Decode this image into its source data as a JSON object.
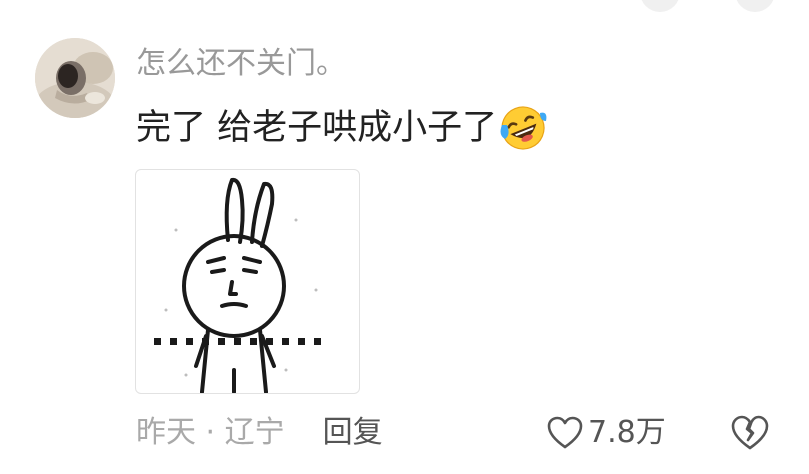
{
  "comment": {
    "username": "怎么还不关门。",
    "text": "完了 给老子哄成小子了",
    "emoji_icon": "rolling-on-floor-laughing-emoji",
    "sticker_icon": "rabbit-meme-sticker",
    "avatar_icon": "user-avatar",
    "time_location": "昨天 · 辽宁",
    "reply_label": "回复",
    "like_count": "7.8万",
    "like_icon": "heart-outline-icon",
    "dislike_icon": "broken-heart-icon"
  },
  "colors": {
    "username": "#999999",
    "text": "#222222",
    "meta": "#a9a9a9",
    "action": "#555555"
  }
}
